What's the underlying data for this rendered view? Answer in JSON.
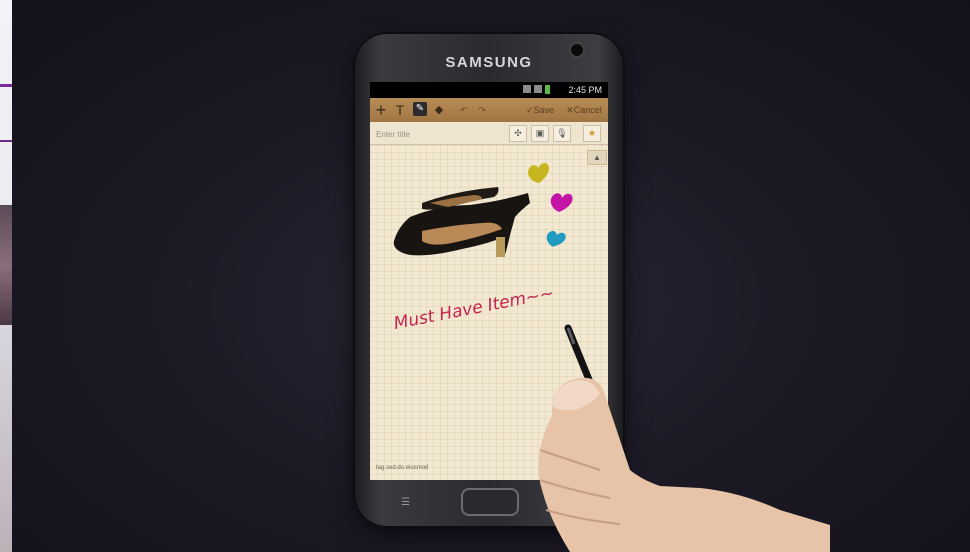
{
  "device": {
    "brand": "SAMSUNG"
  },
  "status_bar": {
    "time": "2:45 PM"
  },
  "toolbar": {
    "add_icon": "+",
    "text_icon": "T",
    "pen_icon": "✎",
    "eraser_icon": "◆",
    "undo_icon": "↶",
    "redo_icon": "↷",
    "save_label": "✓Save",
    "cancel_label": "✕Cancel"
  },
  "title_row": {
    "placeholder": "Enter title",
    "move_icon": "✣",
    "image_icon": "▣",
    "mic_icon": "🎙",
    "star_icon": "★"
  },
  "note": {
    "collapse_icon": "▲",
    "handwriting": "Must Have Item~~",
    "tag": "tag.sed.do.eiusmod"
  },
  "hardkeys": {
    "menu_icon": "☰"
  },
  "colors": {
    "toolbar": "#a97d48",
    "note_background": "#f3e9d2",
    "handwriting": "#c4244f",
    "heart_yellow": "#c7b51f",
    "heart_magenta": "#c414a6",
    "heart_blue": "#1f9ac0",
    "star": "#e0922a"
  }
}
